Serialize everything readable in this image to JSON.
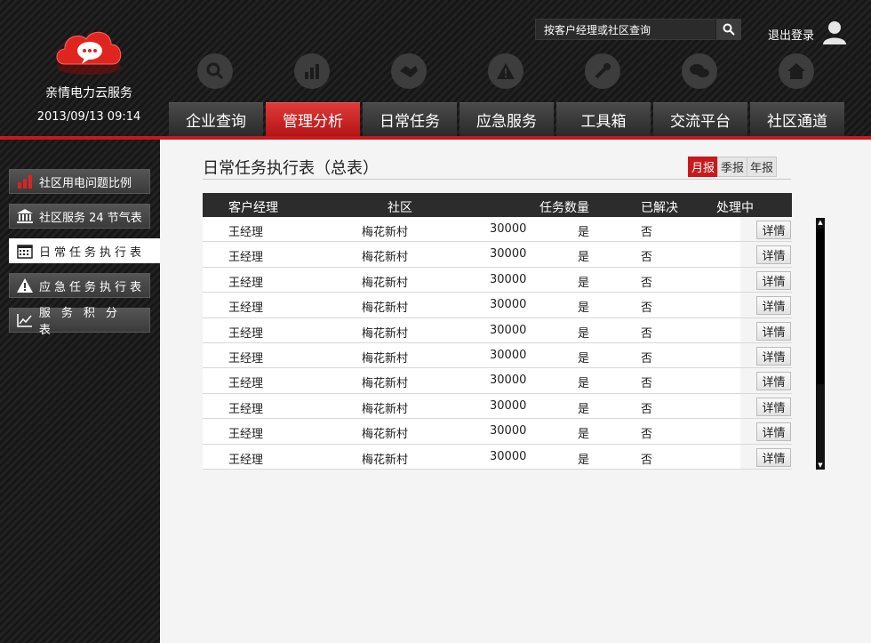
{
  "brand": {
    "app_name": "亲情电力云服务",
    "datetime": "2013/09/13 09:14",
    "logo_icon": "cloud-chat-icon"
  },
  "header": {
    "search_placeholder": "按客户经理或社区查询",
    "logout_label": "退出登录"
  },
  "nav": {
    "icons": [
      "search-icon",
      "bar-chart-icon",
      "handshake-icon",
      "warning-icon",
      "wrench-icon",
      "chat-bubbles-icon",
      "home-icon"
    ],
    "tabs": [
      {
        "label": "企业查询",
        "active": false
      },
      {
        "label": "管理分析",
        "active": true
      },
      {
        "label": "日常任务",
        "active": false
      },
      {
        "label": "应急服务",
        "active": false
      },
      {
        "label": "工具箱",
        "active": false
      },
      {
        "label": "交流平台",
        "active": false
      },
      {
        "label": "社区通道",
        "active": false
      }
    ]
  },
  "sidebar": {
    "items": [
      {
        "label": "社区用电问题比例",
        "icon": "bar-chart-icon",
        "active": false
      },
      {
        "label": "社区服务 24 节气表",
        "icon": "bank-icon",
        "active": false
      },
      {
        "label": "日常任务执行表",
        "icon": "calendar-icon",
        "active": true
      },
      {
        "label": "应急任务执行表",
        "icon": "warning-icon",
        "active": false
      },
      {
        "label": "服务积分表",
        "icon": "line-chart-icon",
        "active": false
      }
    ]
  },
  "main": {
    "title": "日常任务执行表（总表）",
    "period_tabs": [
      {
        "label": "月报",
        "active": true
      },
      {
        "label": "季报",
        "active": false
      },
      {
        "label": "年报",
        "active": false
      }
    ],
    "table": {
      "headers": [
        "客户经理",
        "社区",
        "任务数量",
        "已解决",
        "处理中"
      ],
      "detail_label": "详情",
      "rows": [
        [
          "王经理",
          "梅花新村",
          "30000",
          "是",
          "否"
        ],
        [
          "王经理",
          "梅花新村",
          "30000",
          "是",
          "否"
        ],
        [
          "王经理",
          "梅花新村",
          "30000",
          "是",
          "否"
        ],
        [
          "王经理",
          "梅花新村",
          "30000",
          "是",
          "否"
        ],
        [
          "王经理",
          "梅花新村",
          "30000",
          "是",
          "否"
        ],
        [
          "王经理",
          "梅花新村",
          "30000",
          "是",
          "否"
        ],
        [
          "王经理",
          "梅花新村",
          "30000",
          "是",
          "否"
        ],
        [
          "王经理",
          "梅花新村",
          "30000",
          "是",
          "否"
        ],
        [
          "王经理",
          "梅花新村",
          "30000",
          "是",
          "否"
        ],
        [
          "王经理",
          "梅花新村",
          "30000",
          "是",
          "否"
        ]
      ]
    }
  },
  "colors": {
    "accent": "#c8191c",
    "nav_dark": "#2c2c2c",
    "content_bg": "#f4f4f4"
  }
}
